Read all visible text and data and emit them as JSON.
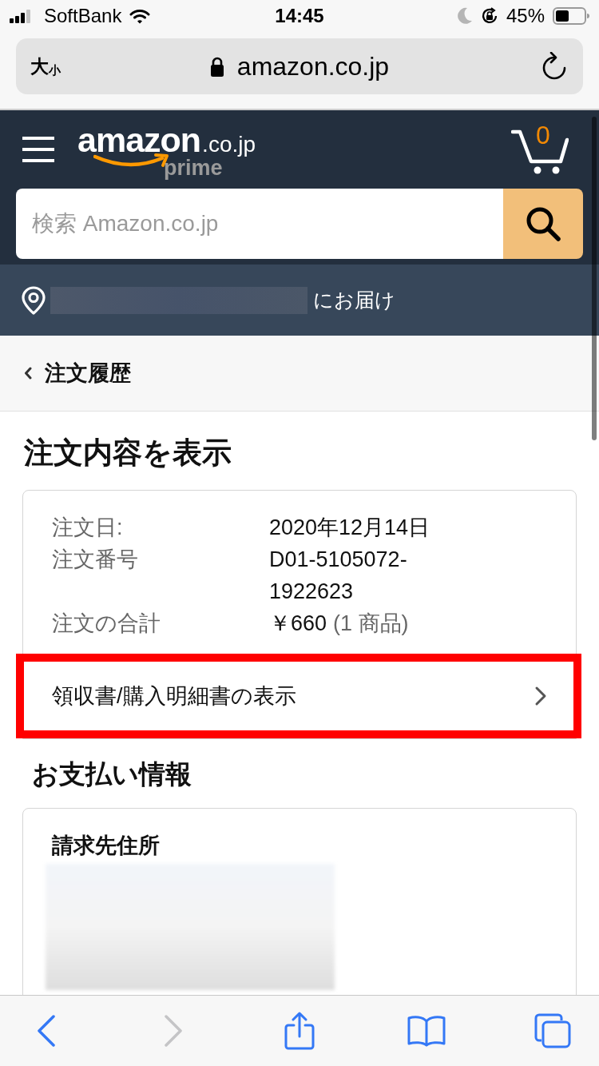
{
  "status_bar": {
    "carrier": "SoftBank",
    "time": "14:45",
    "battery_percent": "45%"
  },
  "address_bar": {
    "text_size_large": "大",
    "text_size_small": "小",
    "url": "amazon.co.jp"
  },
  "header": {
    "logo": {
      "wordmark": "amazon",
      "domain": ".co.jp",
      "tier": "prime"
    },
    "cart_count": "0"
  },
  "search": {
    "placeholder": "検索 Amazon.co.jp"
  },
  "delivery_bar": {
    "suffix": "にお届け"
  },
  "breadcrumb": {
    "label": "注文履歴"
  },
  "page_title": "注文内容を表示",
  "order_summary": {
    "rows": [
      {
        "label": "注文日:",
        "value": "2020年12月14日"
      },
      {
        "label": "注文番号",
        "value": "D01-5105072-1922623"
      },
      {
        "label": "注文の合計",
        "value": "￥660",
        "note": "(1 商品)"
      }
    ]
  },
  "receipt_link": {
    "label": "領収書/購入明細書の表示",
    "highlighted": true
  },
  "payment_info": {
    "heading": "お支払い情報",
    "billing_address_label": "請求先住所"
  },
  "toolbar": [
    {
      "kind": "back",
      "disabled": false
    },
    {
      "kind": "forward",
      "disabled": true
    },
    {
      "kind": "share",
      "disabled": false
    },
    {
      "kind": "bookmarks",
      "disabled": false
    },
    {
      "kind": "tabs",
      "disabled": false
    }
  ]
}
